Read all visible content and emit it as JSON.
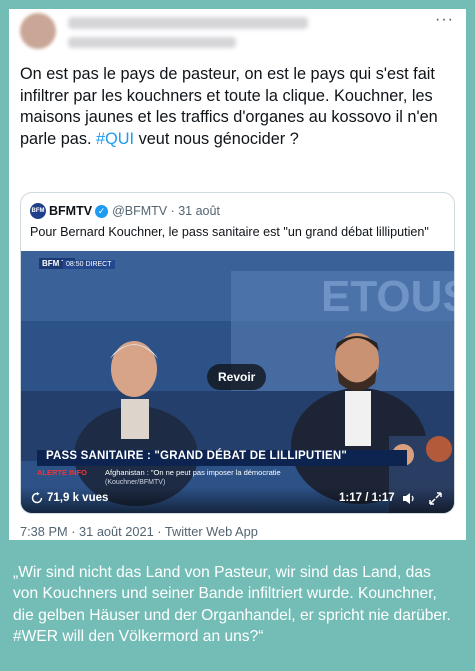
{
  "tweet": {
    "text_parts": {
      "before": "On est pas le pays de pasteur, on est le pays qui s'est fait infiltrer par les kouchners et toute la clique. Kouchner, les maisons jaunes et les traffics d'organes au kossovo il n'en parle pas. ",
      "hashtag": "#QUI",
      "after": " veut nous génocider ?"
    },
    "more_label": "···",
    "meta": "7:38 PM · 31 août 2021 · Twitter Web App"
  },
  "quoted": {
    "logo_text": "BFM",
    "name": "BFMTV",
    "handle_date": "@BFMTV · 31 août",
    "verified_glyph": "✓",
    "text": "Pour Bernard Kouchner, le pass sanitaire est \"un grand débat lilliputien\""
  },
  "video": {
    "channel_logo": "BFM TV",
    "live_tag": "08:50 DIRECT",
    "revoir_label": "Revoir",
    "banner": "PASS SANITAIRE : \"GRAND DÉBAT DE LILLIPUTIEN\"",
    "alert_label": "ALERTE INFO",
    "ticker": "Afghanistan : \"On ne peut pas imposer la démocratie",
    "ticker_source": "(Kouchner/BFMTV)",
    "views": "71,9 k vues",
    "time": "1:17 / 1:17"
  },
  "translation": "„Wir sind nicht das Land von Pasteur, wir sind das Land, das von Kouchners und seiner Bande infiltriert wurde. Kounchner, die gelben Häuser und der Organhandel, er spricht nie darüber. #WER will den Völkermord an uns?“",
  "colors": {
    "background": "#74bdb6",
    "hashtag": "#1d9bf0",
    "banner": "#0e2450"
  }
}
